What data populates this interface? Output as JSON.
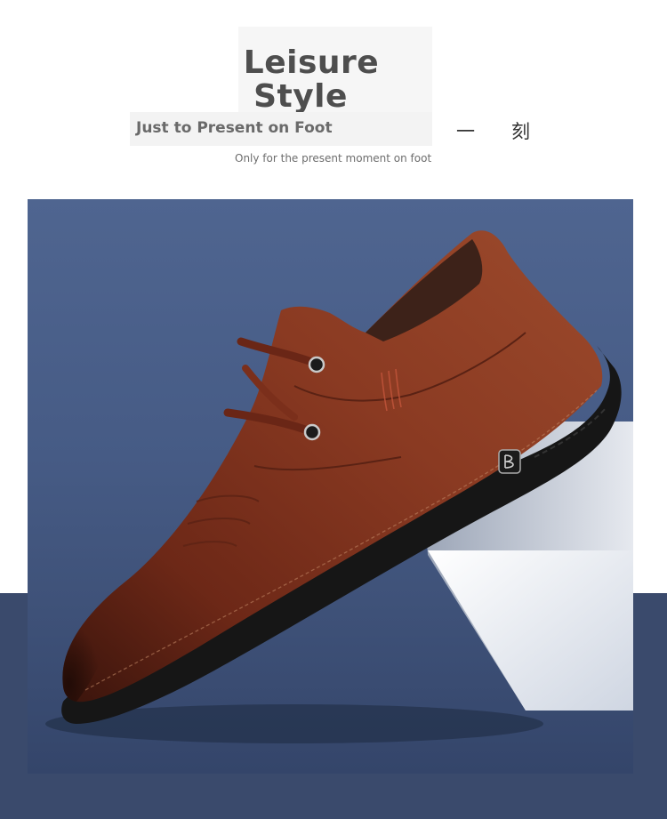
{
  "header": {
    "title_line1": "Leisure",
    "title_line2": "Style",
    "subtitle": "Just to Present on Foot",
    "cjk_char1": "一",
    "cjk_char2": "刻",
    "tagline": "Only for the present moment on foot"
  },
  "product": {
    "image_subject": "brown-leather-lace-up-shoe",
    "colors": {
      "leather": "#7a2e1c",
      "sole": "#151515",
      "background": "#465b85",
      "pedestal": "#e9edf3"
    }
  }
}
